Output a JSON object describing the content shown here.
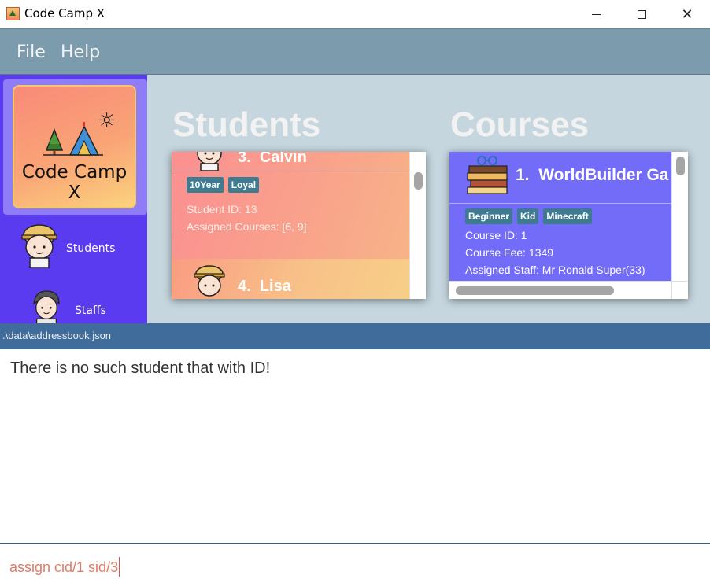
{
  "window": {
    "title": "Code Camp X"
  },
  "menu": {
    "file": "File",
    "help": "Help"
  },
  "sidebar": {
    "logo_text": "Code Camp X",
    "items": [
      {
        "label": "Students",
        "icon": "student-avatar-icon"
      },
      {
        "label": "Staffs",
        "icon": "staff-avatar-icon"
      }
    ]
  },
  "students": {
    "title": "Students",
    "cards": [
      {
        "index": "3.",
        "name": "Calvin",
        "tags": [
          "10Year",
          "Loyal"
        ],
        "id_line": "Student ID: 13",
        "courses_line": "Assigned Courses: [6, 9]"
      },
      {
        "index": "4.",
        "name": "Lisa"
      }
    ]
  },
  "courses": {
    "title": "Courses",
    "cards": [
      {
        "index": "1.",
        "name": "WorldBuilder Ga",
        "tags": [
          "Beginner",
          "Kid",
          "Minecraft"
        ],
        "id_line": "Course ID: 1",
        "fee_line": "Course Fee: 1349",
        "staff_line": "Assigned Staff: Mr Ronald Super(33)"
      }
    ]
  },
  "status": {
    "path": ".\\data\\addressbook.json"
  },
  "result": {
    "message": "There is no such student that with ID!"
  },
  "command": {
    "value": "assign cid/1 sid/3"
  },
  "colors": {
    "menubar": "#7c9bad",
    "sidebar": "#5b3bf0",
    "course_card": "#736cf9",
    "statusbar": "#3f6c9a",
    "command_text": "#e27b67"
  }
}
